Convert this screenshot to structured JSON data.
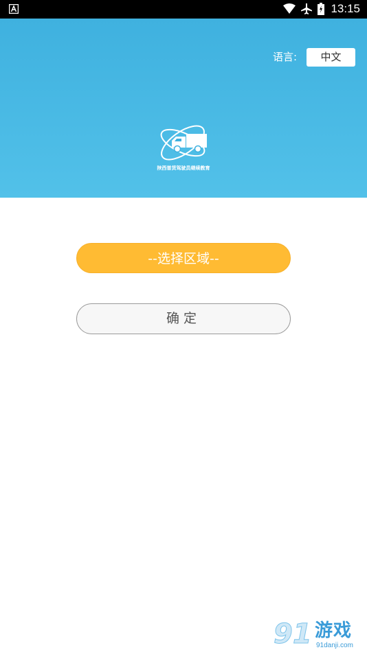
{
  "status_bar": {
    "time": "13:15",
    "icons": [
      "notification-a-icon",
      "wifi-icon",
      "airplane-icon",
      "battery-icon"
    ]
  },
  "header": {
    "language_label": "语言:",
    "language_value": "中文",
    "logo_caption": "陕西普货驾驶员继续教育",
    "colors": {
      "gradient_top": "#3fb1df",
      "gradient_bottom": "#52c1e9"
    }
  },
  "main": {
    "region_button_label": "--选择区域--",
    "confirm_button_label": "确定",
    "colors": {
      "region_button": "#ffbb33",
      "confirm_button_border": "#999999"
    }
  },
  "watermark": {
    "logo_text": "91",
    "name": "游戏",
    "url": "91danji.com"
  }
}
